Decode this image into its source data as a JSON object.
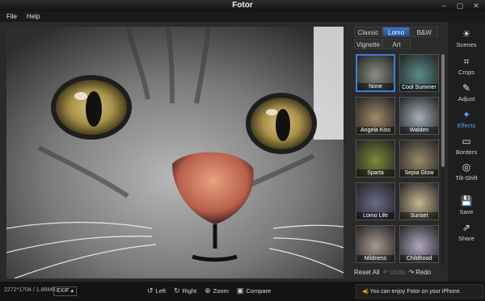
{
  "window": {
    "title": "Fotor",
    "controls": [
      "–",
      "▢",
      "✕"
    ]
  },
  "menu": [
    "File",
    "Help"
  ],
  "panel": {
    "tabs_row1": [
      {
        "label": "Classic",
        "active": false
      },
      {
        "label": "Lomo",
        "active": true
      },
      {
        "label": "B&W",
        "active": false
      }
    ],
    "tabs_row2": [
      {
        "label": "Vignette",
        "active": false
      },
      {
        "label": "Art",
        "active": false
      }
    ],
    "effects": [
      {
        "label": "None",
        "selected": true,
        "tint": "#8e8e84"
      },
      {
        "label": "Cool Summer",
        "selected": false,
        "tint": "#5a8c8a"
      },
      {
        "label": "Angela Kiss",
        "selected": false,
        "tint": "#a08a6a"
      },
      {
        "label": "Walden",
        "selected": false,
        "tint": "#a2b0b8"
      },
      {
        "label": "Sparta",
        "selected": false,
        "tint": "#7a8a3a"
      },
      {
        "label": "Sepia Glow",
        "selected": false,
        "tint": "#9a8a6a"
      },
      {
        "label": "Lomo Life",
        "selected": false,
        "tint": "#6a6a8a"
      },
      {
        "label": "Sunset",
        "selected": false,
        "tint": "#c8b890"
      },
      {
        "label": "Mildness",
        "selected": false,
        "tint": "#a89a90"
      },
      {
        "label": "Childhood",
        "selected": false,
        "tint": "#b0a8c0"
      }
    ],
    "reset_label": "Reset All",
    "undo_label": "Undo",
    "redo_label": "Redo"
  },
  "tools": [
    {
      "label": "Scenes",
      "icon": "sun-icon",
      "glyph": "☀",
      "active": false
    },
    {
      "label": "Crops",
      "icon": "crop-icon",
      "glyph": "⌗",
      "active": false
    },
    {
      "label": "Adjust",
      "icon": "pencil-icon",
      "glyph": "✎",
      "active": false
    },
    {
      "label": "Effects",
      "icon": "sparkle-icon",
      "glyph": "✦",
      "active": true
    },
    {
      "label": "Borders",
      "icon": "frame-icon",
      "glyph": "▭",
      "active": false
    },
    {
      "label": "Tilt-Shift",
      "icon": "focus-icon",
      "glyph": "◎",
      "active": false
    },
    {
      "label": "Save",
      "icon": "save-icon",
      "glyph": "💾",
      "active": false
    },
    {
      "label": "Share",
      "icon": "share-icon",
      "glyph": "⇗",
      "active": false
    }
  ],
  "status": {
    "size": "2272*1704 / 1.88MB",
    "exif": "EXIF ▴",
    "left": "Left",
    "right": "Right",
    "zoom": "Zoom",
    "compare": "Compare",
    "notice": "You can enjoy Fotor on your iPhone."
  },
  "colors": {
    "accent": "#3b7fd4",
    "background": "#1b1b1b",
    "panel": "#2a2a2a"
  }
}
